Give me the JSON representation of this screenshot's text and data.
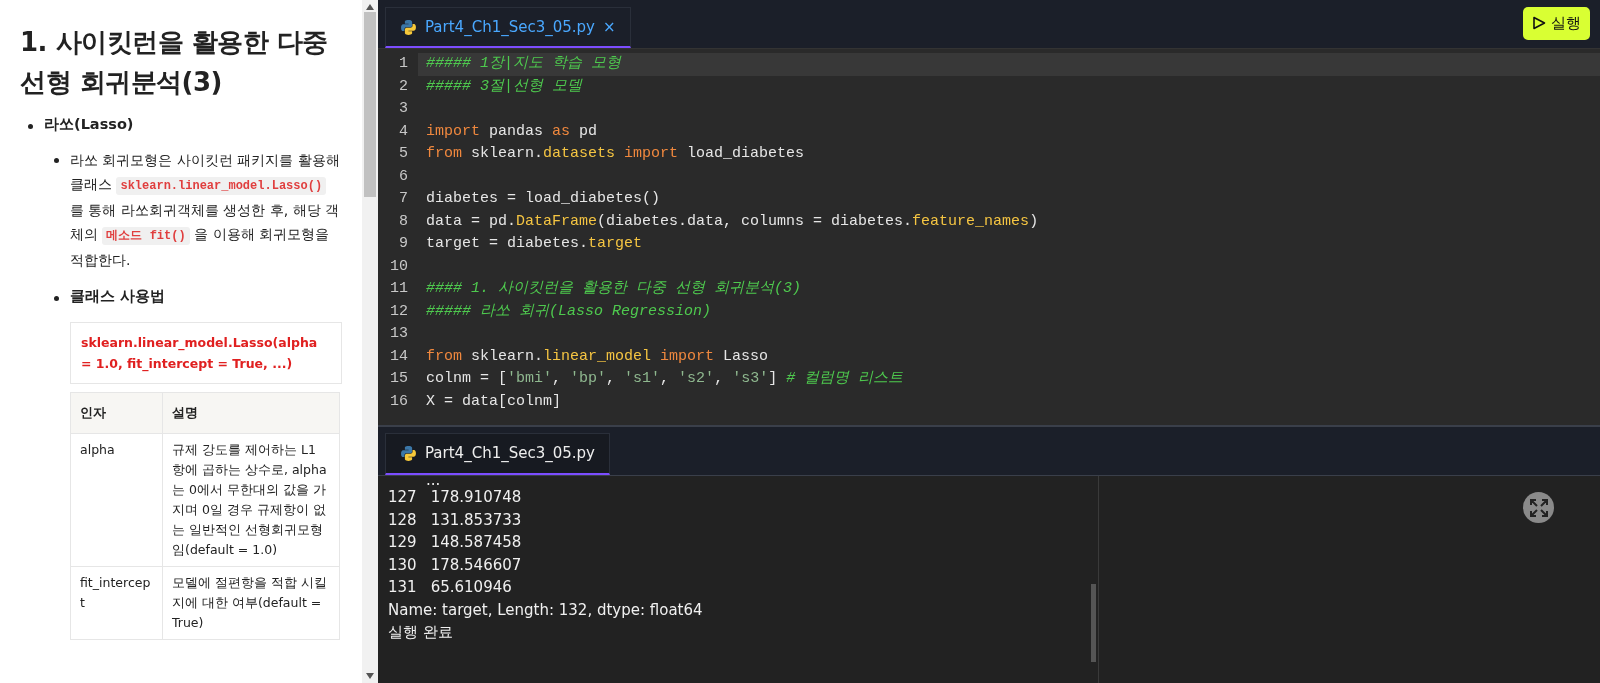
{
  "doc": {
    "title": "1. 사이킷런을 활용한 다중 선형 회귀분석(3)",
    "section": "라쏘(Lasso)",
    "description": [
      {
        "kind": "text",
        "text": "라쏘 회귀모형은 사이킷런 패키지를 활용해 클래스 "
      },
      {
        "kind": "code",
        "text": "sklearn.linear_model.Lasso()"
      },
      {
        "kind": "text",
        "text": " 를 통해 라쏘회귀객체를 생성한 후, 해당 객체의 "
      },
      {
        "kind": "code",
        "text": "메소드 fit()"
      },
      {
        "kind": "text",
        "text": " 을 이용해 회귀모형을 적합한다."
      }
    ],
    "usage_title": "클래스 사용법",
    "signature": "sklearn.linear_model.Lasso(alpha = 1.0, fit_intercept = True, ...)",
    "table": {
      "columns": [
        "인자",
        "설명"
      ],
      "rows": [
        [
          "alpha",
          "규제 강도를 제어하는 L1 항에 곱하는 상수로, alpha는 0에서 무한대의 값을 가지며 0일 경우 규제항이 없는 일반적인 선형회귀모형임(default = 1.0)"
        ],
        [
          "fit_intercept",
          "모델에 절편항을 적합 시킬지에 대한 여부(default = True)"
        ]
      ]
    }
  },
  "editor": {
    "tabs": [
      {
        "label": "Part4_Ch1_Sec3_05.py",
        "selected": true,
        "close": "×"
      }
    ],
    "run_button": "실행",
    "lines": [
      {
        "number": "1",
        "current": true,
        "tokens": [
          {
            "kind": "comment",
            "text": "##### 1장|지도 학습 모형"
          }
        ]
      },
      {
        "number": "2",
        "current": false,
        "tokens": [
          {
            "kind": "comment",
            "text": "##### 3절|선형 모델"
          }
        ]
      },
      {
        "number": "3",
        "current": false
      },
      {
        "number": "4",
        "current": false,
        "tokens": [
          {
            "kind": "keyword",
            "text": "import"
          },
          {
            "kind": "plain",
            "text": " pandas "
          },
          {
            "kind": "keyword",
            "text": "as"
          },
          {
            "kind": "plain",
            "text": " pd"
          }
        ]
      },
      {
        "number": "5",
        "current": false,
        "tokens": [
          {
            "kind": "keyword",
            "text": "from"
          },
          {
            "kind": "plain",
            "text": " sklearn."
          },
          {
            "kind": "attr",
            "text": "datasets"
          },
          {
            "kind": "keyword",
            "text": " import"
          },
          {
            "kind": "plain",
            "text": " load_diabetes"
          }
        ]
      },
      {
        "number": "6",
        "current": false
      },
      {
        "number": "7",
        "current": false,
        "tokens": [
          {
            "kind": "plain",
            "text": "diabetes = load_diabetes()"
          }
        ]
      },
      {
        "number": "8",
        "current": false,
        "tokens": [
          {
            "kind": "plain",
            "text": "data = pd."
          },
          {
            "kind": "attr",
            "text": "DataFrame"
          },
          {
            "kind": "plain",
            "text": "(diabetes.data, columns = diabetes."
          },
          {
            "kind": "attr",
            "text": "feature_names"
          },
          {
            "kind": "plain",
            "text": ")"
          }
        ]
      },
      {
        "number": "9",
        "current": false,
        "tokens": [
          {
            "kind": "plain",
            "text": "target = diabetes."
          },
          {
            "kind": "attr",
            "text": "target"
          }
        ]
      },
      {
        "number": "10",
        "current": false
      },
      {
        "number": "11",
        "current": false,
        "tokens": [
          {
            "kind": "comment",
            "text": "#### 1. 사이킷런을 활용한 다중 선형 회귀분석(3)"
          }
        ]
      },
      {
        "number": "12",
        "current": false,
        "tokens": [
          {
            "kind": "comment",
            "text": "##### 라쏘 회귀(Lasso Regression)"
          }
        ]
      },
      {
        "number": "13",
        "current": false
      },
      {
        "number": "14",
        "current": false,
        "tokens": [
          {
            "kind": "keyword",
            "text": "from"
          },
          {
            "kind": "plain",
            "text": " sklearn."
          },
          {
            "kind": "attr",
            "text": "linear_model"
          },
          {
            "kind": "keyword",
            "text": " import"
          },
          {
            "kind": "plain",
            "text": " Lasso"
          }
        ]
      },
      {
        "number": "15",
        "current": false,
        "tokens": [
          {
            "kind": "plain",
            "text": "colnm = ["
          },
          {
            "kind": "string",
            "text": "'bmi'"
          },
          {
            "kind": "plain",
            "text": ", "
          },
          {
            "kind": "string",
            "text": "'bp'"
          },
          {
            "kind": "plain",
            "text": ", "
          },
          {
            "kind": "string",
            "text": "'s1'"
          },
          {
            "kind": "plain",
            "text": ", "
          },
          {
            "kind": "string",
            "text": "'s2'"
          },
          {
            "kind": "plain",
            "text": ", "
          },
          {
            "kind": "string",
            "text": "'s3'"
          },
          {
            "kind": "plain",
            "text": "] "
          },
          {
            "kind": "comment",
            "text": "# 컬럼명 리스트"
          }
        ]
      },
      {
        "number": "16",
        "current": false,
        "tokens": [
          {
            "kind": "plain",
            "text": "X = data[colnm]"
          }
        ]
      }
    ]
  },
  "output": {
    "tabs": [
      {
        "label": "Part4_Ch1_Sec3_05.py",
        "selected": true
      }
    ],
    "ellipsis": "...",
    "rows": [
      {
        "index": "127",
        "value": "178.910748"
      },
      {
        "index": "128",
        "value": "131.853733"
      },
      {
        "index": "129",
        "value": "148.587458"
      },
      {
        "index": "130",
        "value": "178.546607"
      },
      {
        "index": "131",
        "value": "65.610946"
      }
    ],
    "summary": "Name: target, Length: 132, dtype: float64",
    "status": "실행 완료"
  }
}
